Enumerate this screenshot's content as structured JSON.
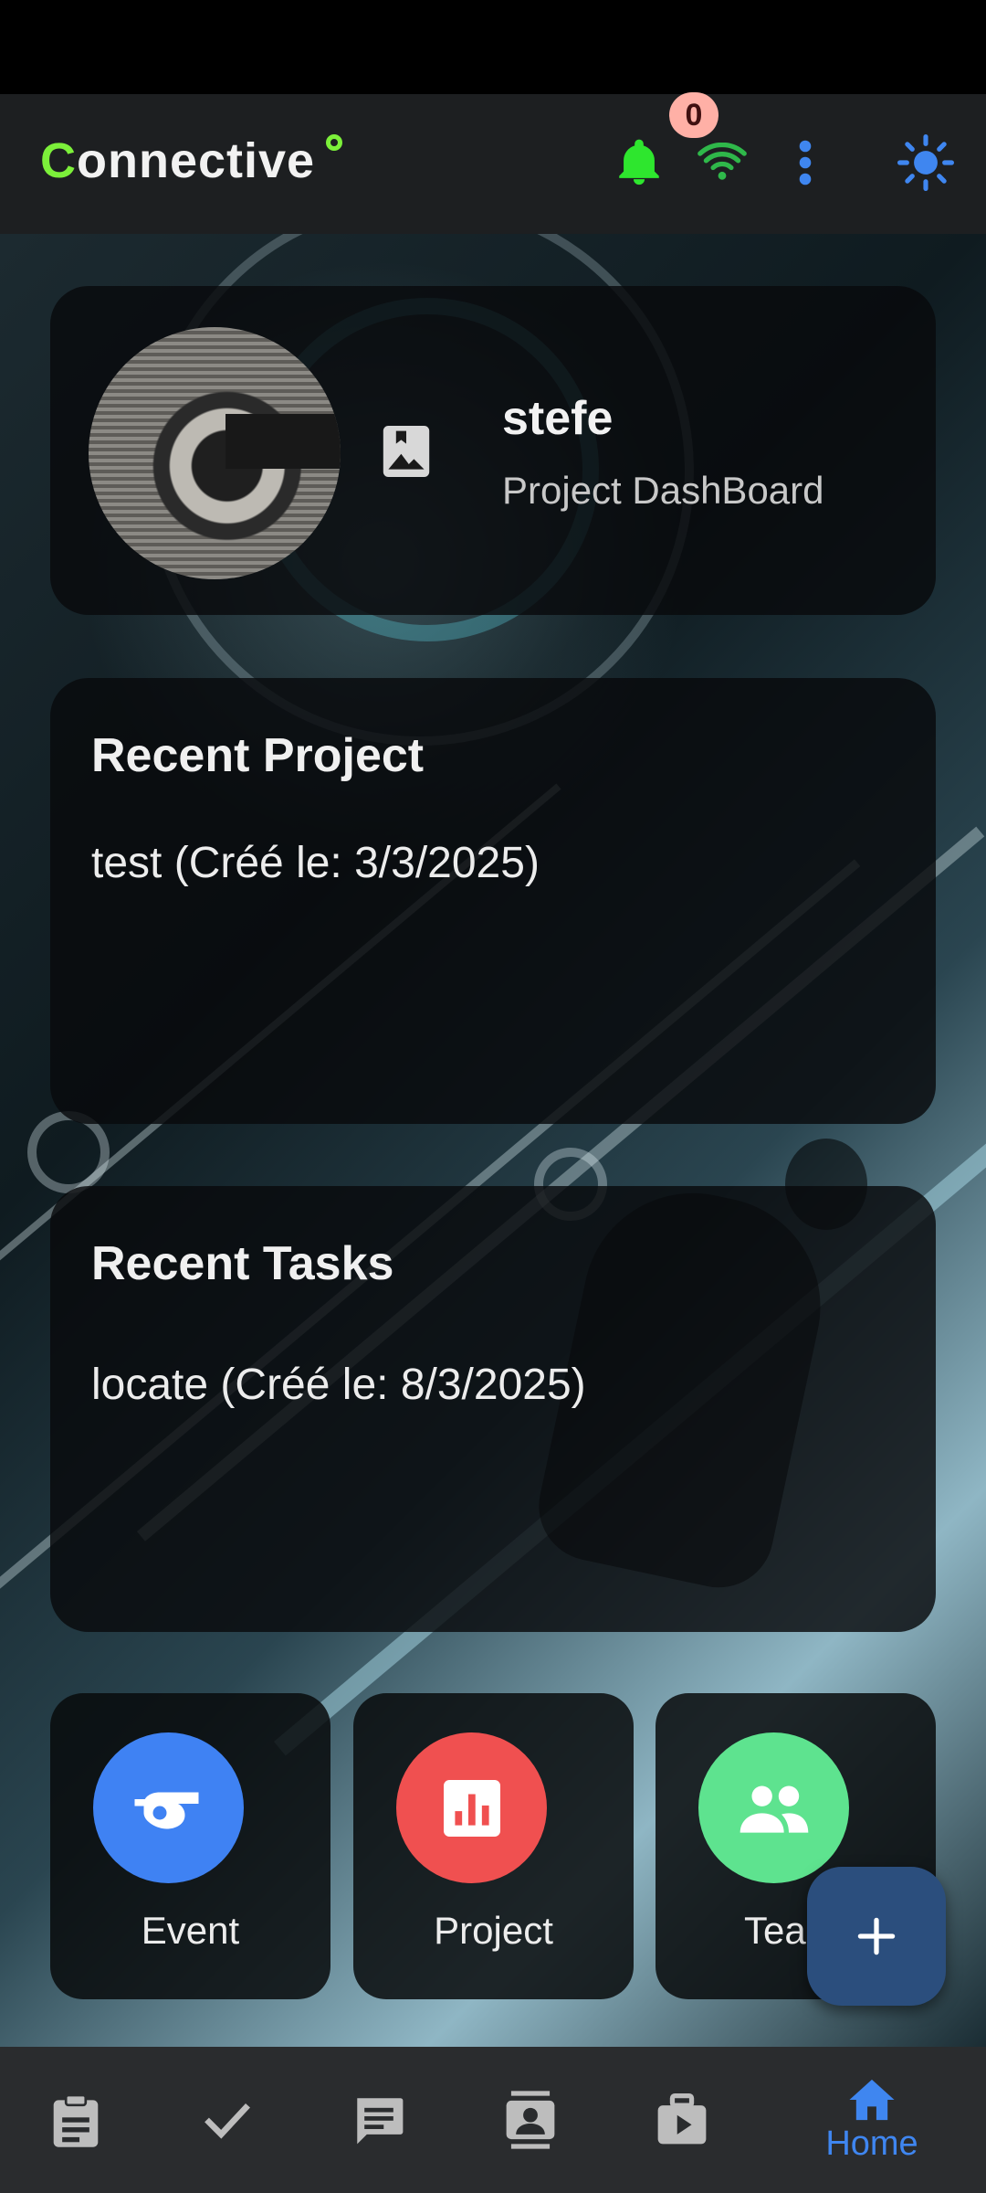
{
  "app": {
    "logo_first": "C",
    "logo_rest": "onnective",
    "notification_count": "0"
  },
  "profile": {
    "name": "stefe",
    "subtitle": "Project DashBoard"
  },
  "recent_project": {
    "title": "Recent Project",
    "items": [
      "test (Créé le: 3/3/2025)"
    ]
  },
  "recent_tasks": {
    "title": "Recent Tasks",
    "items": [
      "locate  (Créé le: 8/3/2025)"
    ]
  },
  "shortcuts": [
    {
      "label": "Event",
      "color": "#3f82f3",
      "icon": "whistle-icon"
    },
    {
      "label": "Project",
      "color": "#f05050",
      "icon": "chart-icon"
    },
    {
      "label": "Tea",
      "color": "#5ee38f",
      "icon": "team-icon"
    }
  ],
  "fab": {
    "icon": "plus-icon"
  },
  "bottom_nav": {
    "items": [
      {
        "icon": "clipboard-icon"
      },
      {
        "icon": "check-icon"
      },
      {
        "icon": "message-icon"
      },
      {
        "icon": "contact-card-icon"
      },
      {
        "icon": "play-case-icon"
      },
      {
        "icon": "home-icon",
        "label": "Home",
        "active": true
      }
    ]
  },
  "colors": {
    "accent_green": "#7cf03a",
    "accent_blue": "#3f86f0",
    "bell_green": "#2ee62e"
  }
}
